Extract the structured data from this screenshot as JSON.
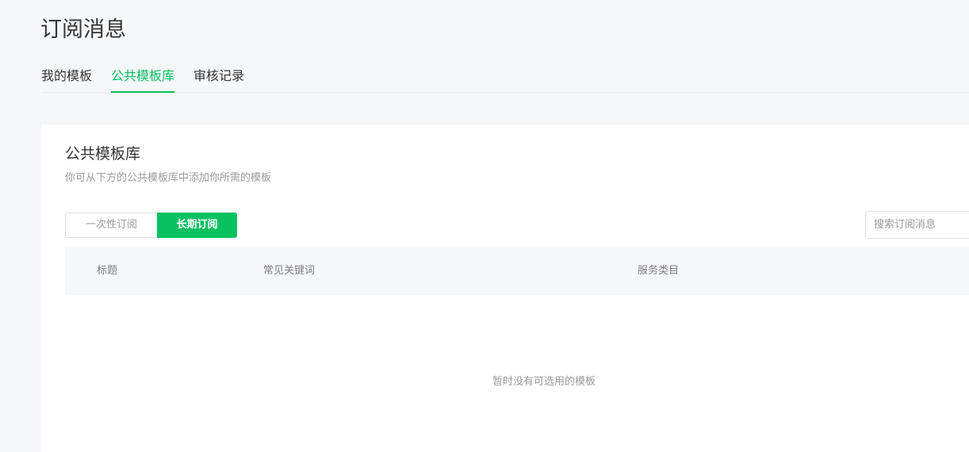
{
  "page": {
    "title": "订阅消息"
  },
  "tabs": [
    {
      "label": "我的模板",
      "active": false
    },
    {
      "label": "公共模板库",
      "active": true
    },
    {
      "label": "审核记录",
      "active": false
    }
  ],
  "panel": {
    "title": "公共模板库",
    "description": "你可从下方的公共模板库中添加你所需的模板",
    "segments": [
      {
        "label": "一次性订阅",
        "selected": false
      },
      {
        "label": "长期订阅",
        "selected": true
      }
    ],
    "search": {
      "placeholder": "搜索订阅消息",
      "value": ""
    },
    "table": {
      "columns": [
        "标题",
        "常见关键词",
        "服务类目"
      ],
      "rows": []
    },
    "empty_text": "暂时没有可选用的模板"
  },
  "colors": {
    "accent": "#07c160",
    "background": "#f6f7f9",
    "card": "#ffffff",
    "muted_text": "#9a9a9a"
  }
}
